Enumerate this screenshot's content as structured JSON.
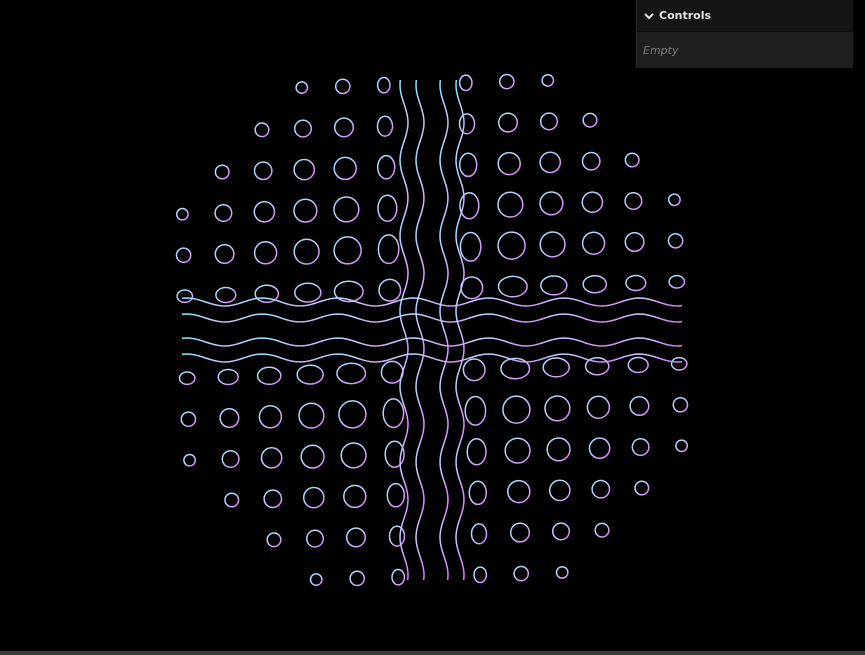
{
  "controls": {
    "title": "Controls",
    "empty_label": "Empty",
    "chevron_icon": "chevron-down-icon"
  },
  "visual": {
    "description_colors": {
      "top_left": "#8fd8ff",
      "bottom_left": "#8aa6ff",
      "top_right": "#ffffff",
      "bottom_right": "#e07aff"
    },
    "background": "#000000",
    "panel_background": "#1a1a1a"
  }
}
